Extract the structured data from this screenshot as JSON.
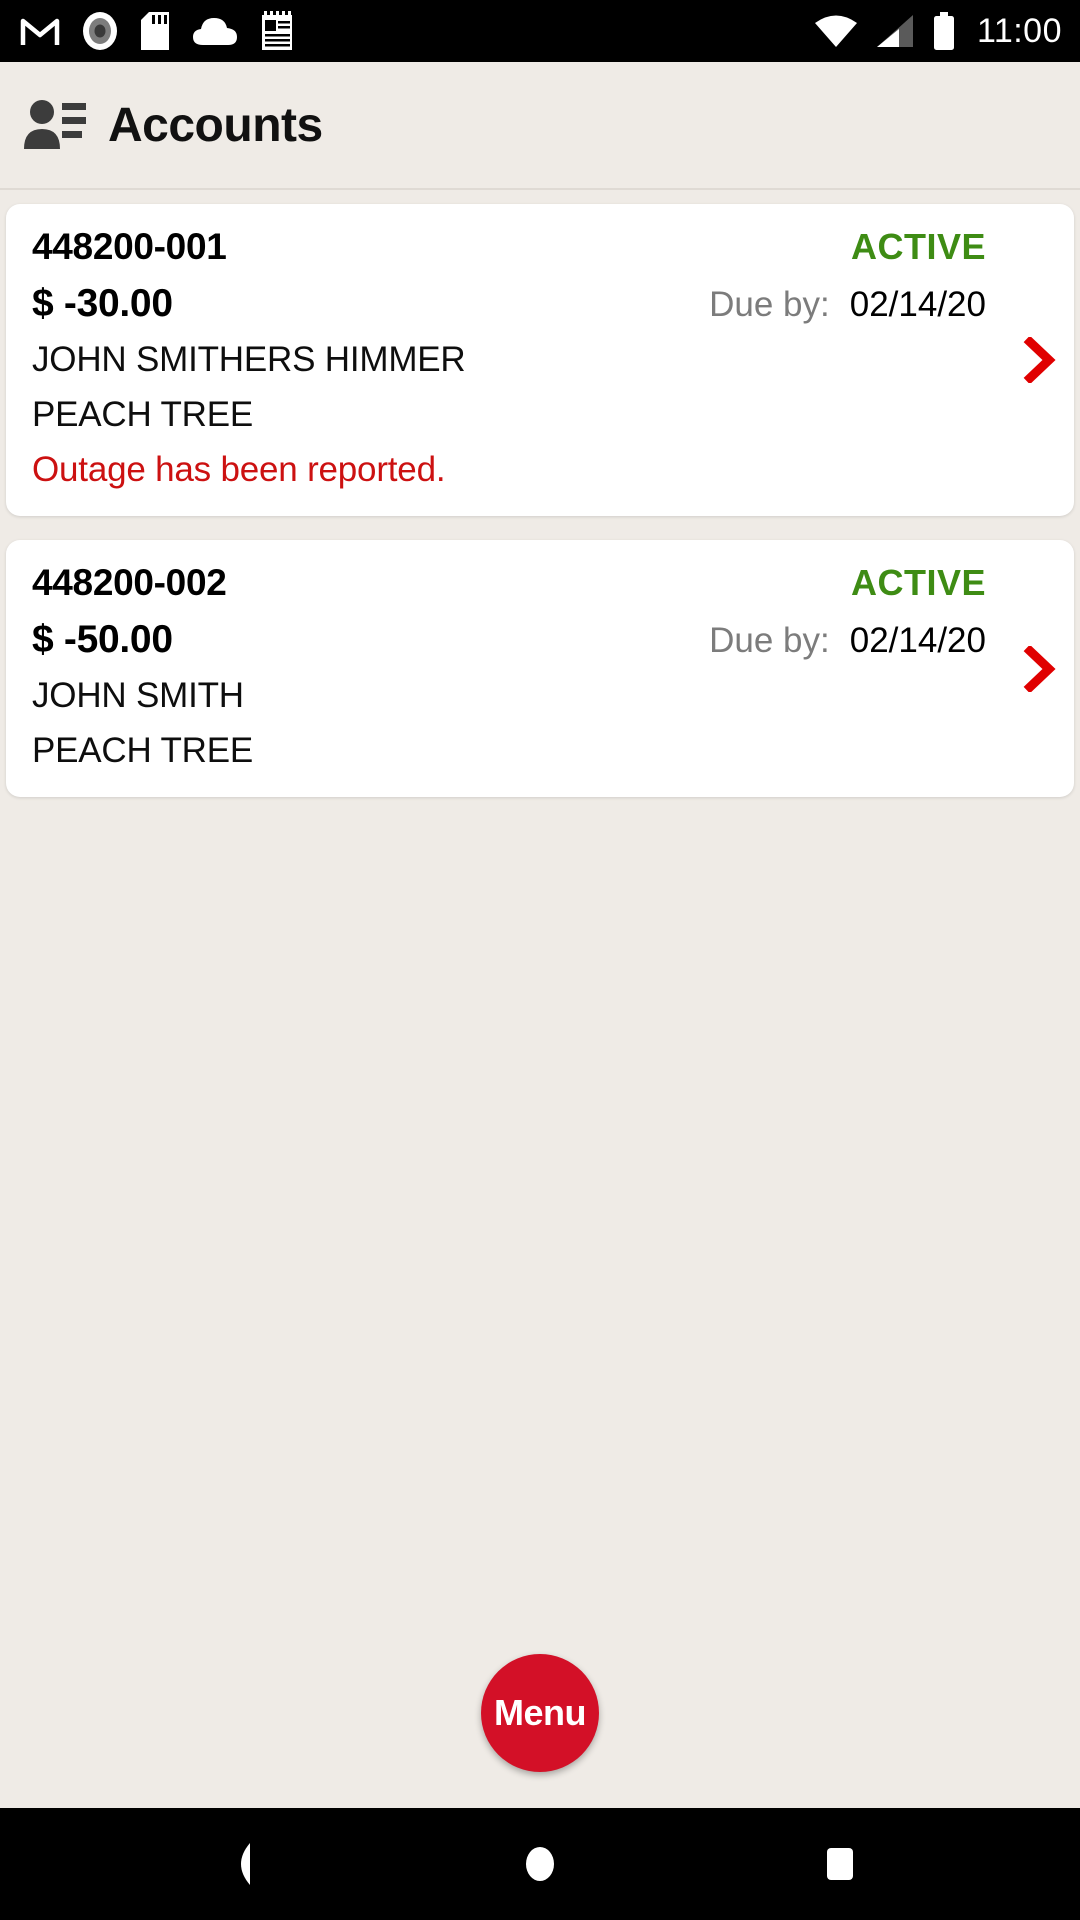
{
  "status_bar": {
    "time": "11:00",
    "left_icons": [
      "gmail-icon",
      "record-icon",
      "sd-card-icon",
      "cloud-icon",
      "notes-icon"
    ],
    "right_icons": [
      "wifi-icon",
      "cellular-signal-icon",
      "battery-icon"
    ]
  },
  "header": {
    "title": "Accounts",
    "icon": "contact-account-icon"
  },
  "colors": {
    "background": "#EFEBE6",
    "card": "#FFFFFF",
    "status_active": "#3E8C14",
    "alert": "#CC1111",
    "chevron": "#E00000",
    "fab": "#D31027"
  },
  "accounts": [
    {
      "account_number": "448200-001",
      "status": "ACTIVE",
      "amount": "$ -30.00",
      "due_label": "Due by:",
      "due_date": "02/14/20",
      "name": "JOHN SMITHERS HIMMER",
      "place": "PEACH TREE",
      "alert": "Outage has been reported.",
      "chevron": "chevron-right-icon"
    },
    {
      "account_number": "448200-002",
      "status": "ACTIVE",
      "amount": "$ -50.00",
      "due_label": "Due by:",
      "due_date": "02/14/20",
      "name": "JOHN SMITH",
      "place": "PEACH TREE",
      "alert": "",
      "chevron": "chevron-right-icon"
    }
  ],
  "fab": {
    "label": "Menu"
  },
  "nav_bar": {
    "back": "back-icon",
    "home": "home-icon",
    "recents": "recents-icon"
  }
}
